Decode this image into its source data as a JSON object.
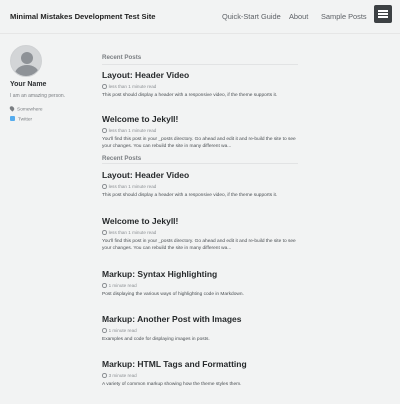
{
  "header": {
    "site_title": "Minimal Mistakes Development Test Site",
    "nav": [
      "Quick-Start Guide",
      "About",
      "Sample Posts"
    ]
  },
  "sidebar": {
    "author_name": "Your Name",
    "author_bio": "I am an amazing person.",
    "links": [
      {
        "label": "Somewhere",
        "icon": "location-icon"
      },
      {
        "label": "Twitter",
        "icon": "twitter-icon"
      }
    ]
  },
  "main": {
    "section_top": "Recent Posts",
    "section_overlap": "Recent Posts",
    "posts_top": [
      {
        "title": "Layout: Header Video",
        "meta": "less than 1 minute read",
        "excerpt": "This post should display a header with a responsive video, if the theme supports it."
      },
      {
        "title": "Welcome to Jekyll!",
        "meta": "less than 1 minute read",
        "excerpt": "You'll find this post in your _posts directory. Go ahead and edit it and re-build the site to see your changes. You can rebuild the site in many different wa..."
      }
    ],
    "posts": [
      {
        "title": "Layout: Header Video",
        "meta": "less than 1 minute read",
        "excerpt": "This post should display a header with a responsive video, if the theme supports it."
      },
      {
        "title": "Welcome to Jekyll!",
        "meta": "less than 1 minute read",
        "excerpt": "You'll find this post in your _posts directory. Go ahead and edit it and re-build the site to see your changes. You can rebuild the site in many different wa..."
      },
      {
        "title": "Markup: Syntax Highlighting",
        "meta": "1 minute read",
        "excerpt": "Post displaying the various ways of highlighting code in Markdown."
      },
      {
        "title": "Markup: Another Post with Images",
        "meta": "1 minute read",
        "excerpt": "Examples and code for displaying images in posts."
      },
      {
        "title": "Markup: HTML Tags and Formatting",
        "meta": "3 minute read",
        "excerpt": "A variety of common markup showing how the theme styles them."
      }
    ]
  }
}
